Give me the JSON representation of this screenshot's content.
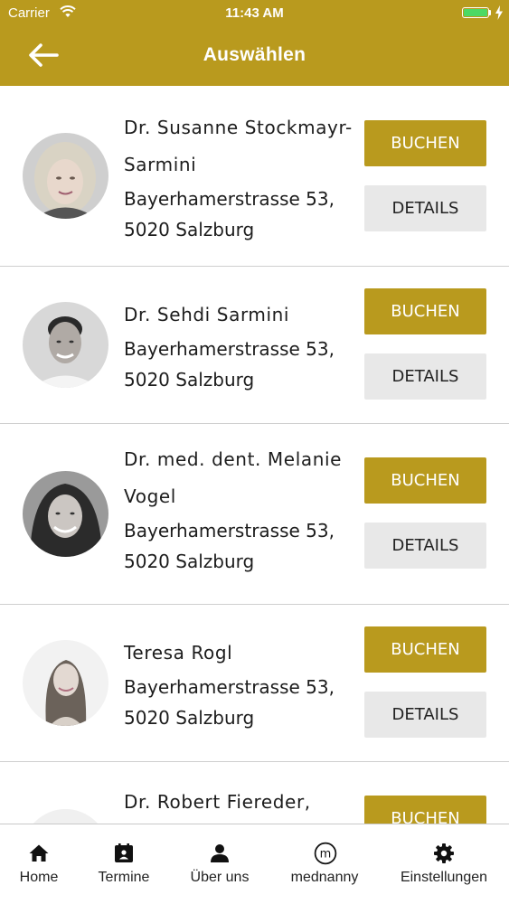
{
  "status_bar": {
    "carrier": "Carrier",
    "time": "11:43 AM"
  },
  "nav": {
    "title": "Auswählen",
    "back_icon": "arrow-left-icon"
  },
  "colors": {
    "brand": "#b99a1e",
    "details_bg": "#e8e8e8",
    "battery": "#4cd964"
  },
  "doctors": [
    {
      "name": "Dr. Susanne Stockmayr-Sarmini",
      "address": "Bayerhamerstrasse 53, 5020 Salzburg",
      "book_label": "BUCHEN",
      "details_label": "DETAILS"
    },
    {
      "name": "Dr. Sehdi Sarmini",
      "address": "Bayerhamerstrasse 53, 5020 Salzburg",
      "book_label": "BUCHEN",
      "details_label": "DETAILS"
    },
    {
      "name": "Dr. med. dent. Melanie Vogel",
      "address": "Bayerhamerstrasse 53, 5020 Salzburg",
      "book_label": "BUCHEN",
      "details_label": "DETAILS"
    },
    {
      "name": "Teresa Rogl",
      "address": "Bayerhamerstrasse 53, 5020 Salzburg",
      "book_label": "BUCHEN",
      "details_label": "DETAILS"
    },
    {
      "name": "Dr. Robert Fiereder,",
      "address": "",
      "book_label": "BUCHEN",
      "details_label": ""
    }
  ],
  "tabs": [
    {
      "label": "Home",
      "icon": "home-icon"
    },
    {
      "label": "Termine",
      "icon": "calendar-icon"
    },
    {
      "label": "Über uns",
      "icon": "person-icon"
    },
    {
      "label": "mednanny",
      "icon": "mednanny-logo-icon"
    },
    {
      "label": "Einstellungen",
      "icon": "gear-icon"
    }
  ]
}
